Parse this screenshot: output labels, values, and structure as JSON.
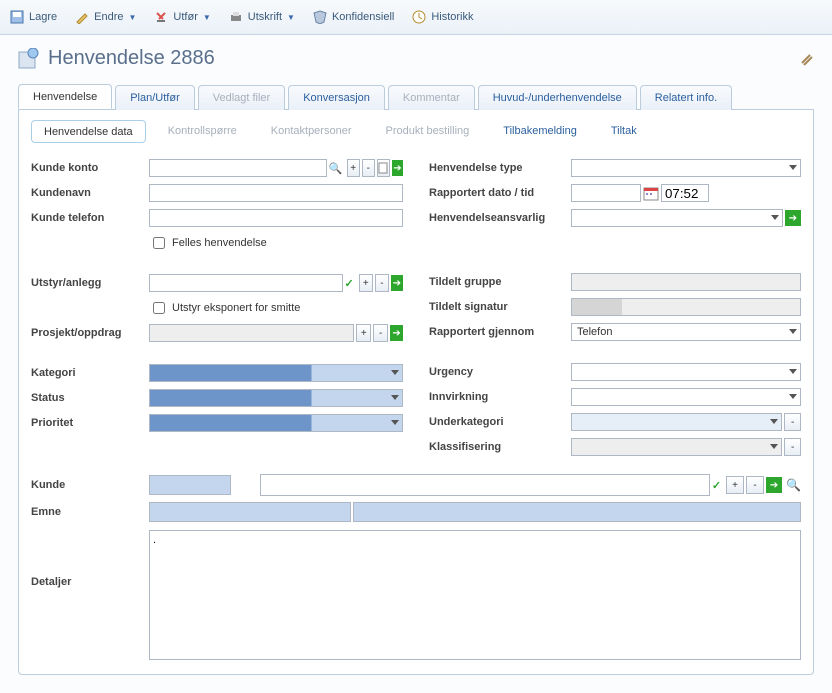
{
  "toolbar": {
    "lagre": "Lagre",
    "endre": "Endre",
    "utfor": "Utfør",
    "utskrift": "Utskrift",
    "konfidensiell": "Konfidensiell",
    "historikk": "Historikk"
  },
  "page": {
    "title": "Henvendelse 2886"
  },
  "tabs": {
    "henvendelse": "Henvendelse",
    "plan_utfor": "Plan/Utfør",
    "vedlagt_filer": "Vedlagt filer",
    "konversasjon": "Konversasjon",
    "kommentar": "Kommentar",
    "huvud_under": "Huvud-/underhenvendelse",
    "relatert": "Relatert info."
  },
  "subtabs": {
    "henvendelse_data": "Henvendelse data",
    "kontrollsporre": "Kontrollspørre",
    "kontaktpersoner": "Kontaktpersoner",
    "produkt_bestilling": "Produkt bestilling",
    "tilbakemelding": "Tilbakemelding",
    "tiltak": "Tiltak"
  },
  "labels": {
    "kunde_konto": "Kunde konto",
    "kundenavn": "Kundenavn",
    "kunde_telefon": "Kunde telefon",
    "felles": "Felles henvendelse",
    "utstyr_anlegg": "Utstyr/anlegg",
    "utstyr_smitte": "Utstyr eksponert for smitte",
    "prosjekt": "Prosjekt/oppdrag",
    "kategori": "Kategori",
    "status": "Status",
    "prioritet": "Prioritet",
    "kunde": "Kunde",
    "emne": "Emne",
    "detaljer": "Detaljer",
    "henvendelse_type": "Henvendelse type",
    "rapportert_dato": "Rapportert dato / tid",
    "henvendelseansvarlig": "Henvendelseansvarlig",
    "tildelt_gruppe": "Tildelt gruppe",
    "tildelt_signatur": "Tildelt signatur",
    "rapportert_gjennom": "Rapportert gjennom",
    "urgency": "Urgency",
    "innvirkning": "Innvirkning",
    "underkategori": "Underkategori",
    "klassifisering": "Klassifisering"
  },
  "values": {
    "kunde_konto": "",
    "kundenavn": "",
    "kunde_telefon": "",
    "utstyr_anlegg": "",
    "prosjekt": "",
    "kategori": "",
    "status": "",
    "prioritet": "",
    "kunde": "",
    "emne": "",
    "detaljer": ".",
    "henvendelse_type": "",
    "rapportert_dato": "",
    "rapportert_tid": "07:52",
    "henvendelseansvarlig": "",
    "tildelt_gruppe": "",
    "tildelt_signatur": "",
    "rapportert_gjennom": "Telefon",
    "urgency": "",
    "innvirkning": "",
    "underkategori": "",
    "klassifisering": ""
  },
  "btn": {
    "plus": "+",
    "minus": "-",
    "doc": "",
    "go": "→"
  }
}
